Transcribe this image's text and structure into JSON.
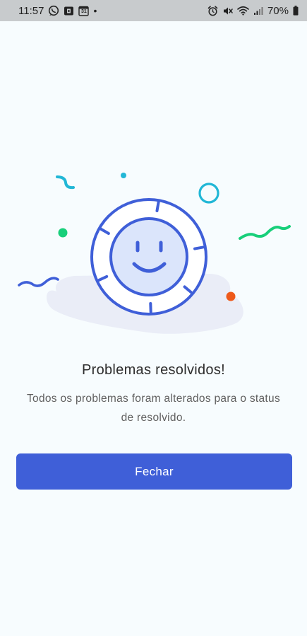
{
  "status_bar": {
    "time": "11:57",
    "dot": "•",
    "calendar_day": "31",
    "battery": "70%",
    "left_icons": [
      "whatsapp-icon",
      "notification-icon",
      "calendar-icon"
    ],
    "right_icons": [
      "alarm-icon",
      "mute-icon",
      "wifi-icon",
      "signal-icon",
      "battery-icon"
    ]
  },
  "illustration": {
    "icon": "smiley-coin-icon",
    "colors": {
      "primary": "#3f5fd8",
      "face_fill": "#dbe5fb",
      "blob": "#eaedf7",
      "cyan": "#22b7d6",
      "green": "#18cf7a",
      "orange": "#ee5a1b"
    }
  },
  "message": {
    "title": "Problemas resolvidos!",
    "subtitle": "Todos os problemas foram alterados para o status de resolvido."
  },
  "actions": {
    "close_label": "Fechar",
    "color": "#3f5fd8"
  }
}
